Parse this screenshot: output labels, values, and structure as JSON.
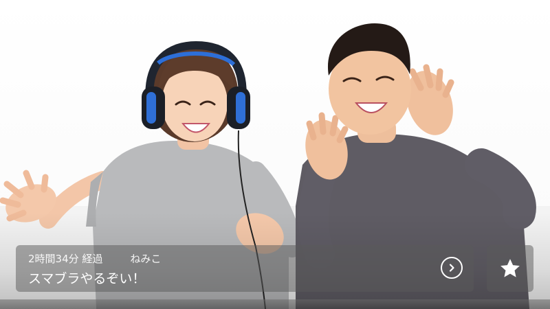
{
  "stream": {
    "elapsed": "2時間34分 経過",
    "streamer": "ねみこ",
    "title": "スマブラやるぞい！"
  },
  "icons": {
    "detail": "chevron-right-circle-icon",
    "favorite": "star-icon"
  },
  "colors": {
    "card_background": "#5a5a5a",
    "icon_color": "#ffffff",
    "background": "#ffffff"
  }
}
